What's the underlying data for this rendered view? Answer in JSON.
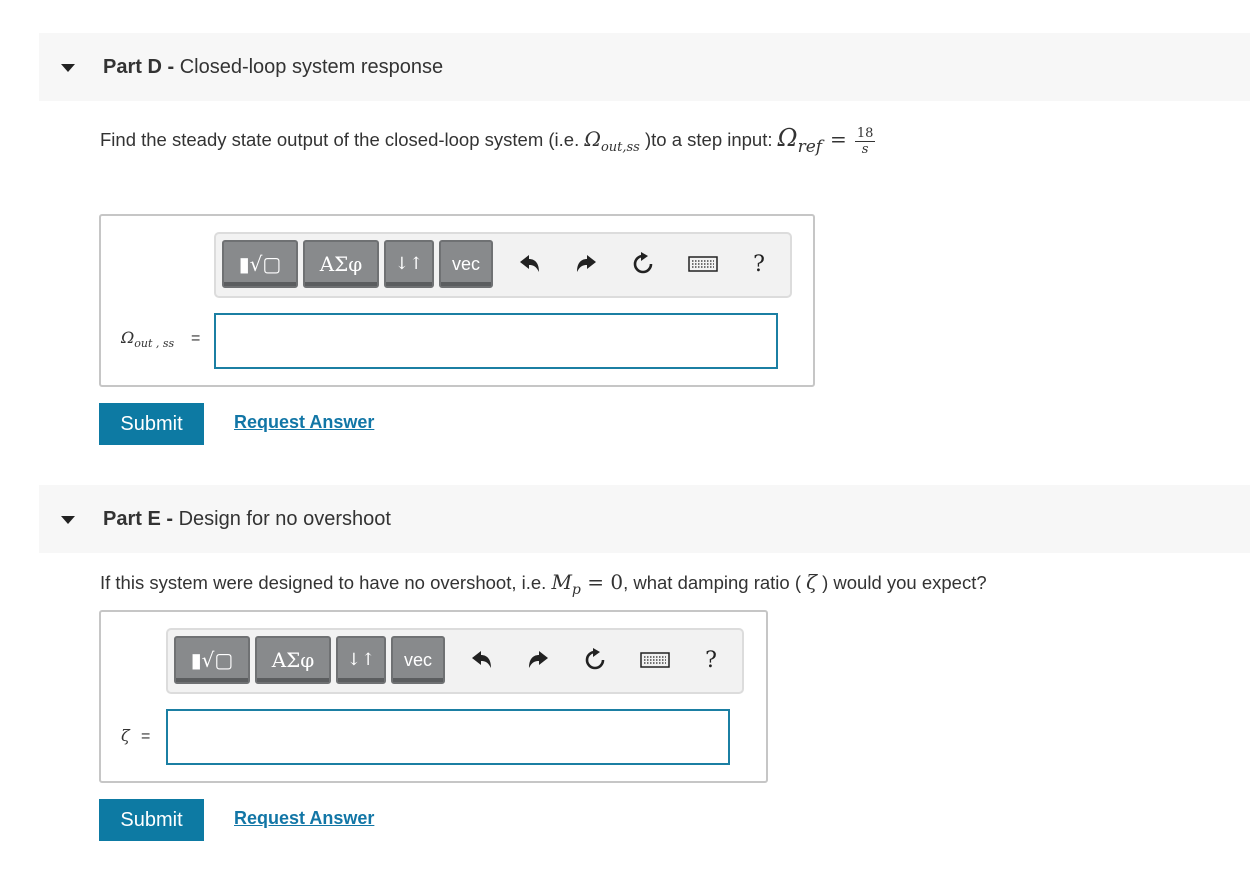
{
  "part_d": {
    "label": "Part D",
    "separator": " - ",
    "title": "Closed-loop system response",
    "question_prefix": "Find the steady state output of the closed-loop system (i.e. ",
    "question_mid": " )to a step input: ",
    "omega": "Ω",
    "out_ss": "out,ss",
    "ref": "ref",
    "equals": "=",
    "frac_num": "18",
    "frac_den": "s",
    "var_omega": "Ω",
    "var_sub": "out , ss",
    "eq_sign": "=",
    "input_value": "",
    "submit_label": "Submit",
    "request_label": "Request Answer"
  },
  "part_e": {
    "label": "Part E",
    "separator": " - ",
    "title": "Design for no overshoot",
    "question_prefix": "If this system were designed to have no overshoot, i.e. ",
    "mp_m": "M",
    "mp_sub": "p",
    "mp_rest": " = 0",
    "question_mid": ", what damping ratio ( ",
    "zeta": "ζ",
    "question_suffix": " ) would you expect?",
    "var_zeta": "ζ",
    "eq_sign": "=",
    "input_value": "",
    "submit_label": "Submit",
    "request_label": "Request Answer"
  },
  "toolbar": {
    "templates_glyph": "▮√▢",
    "greek_label": "ΑΣφ",
    "arrows_label": "↓↑",
    "vec_label": "vec",
    "help_label": "?",
    "icons": [
      "undo-icon",
      "redo-icon",
      "reset-icon",
      "keyboard-icon",
      "help-icon"
    ]
  },
  "colors": {
    "accent": "#0d7aa3",
    "link": "#1276a6",
    "input_border": "#1b7fa3",
    "header_bg": "#f7f7f7",
    "button_gray": "#888a8c"
  }
}
